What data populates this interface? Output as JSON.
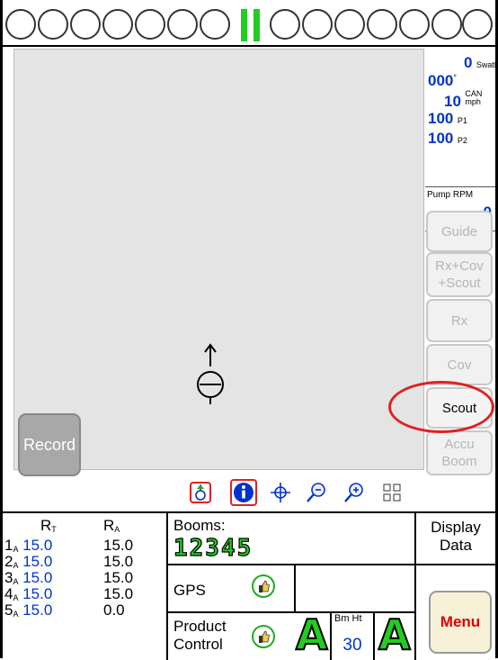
{
  "boom_circles": {
    "left_count": 7,
    "right_count": 7,
    "indicator_color": "#22cc22"
  },
  "status": {
    "swath_value": "0",
    "swath_unit": "Swath",
    "heading_value": "000",
    "heading_unit": "°",
    "speed_value": "10",
    "speed_unit_1": "CAN",
    "speed_unit_2": "mph",
    "p1_value": "100",
    "p1_unit": "P1",
    "p2_value": "100",
    "p2_unit": "P2",
    "pump_label": "Pump RPM",
    "pump_value": "0"
  },
  "buttons": {
    "guide": "Guide",
    "rx_cov_scout_1": "Rx+Cov",
    "rx_cov_scout_2": "+Scout",
    "rx": "Rx",
    "cov": "Cov",
    "scout": "Scout",
    "accu_1": "Accu",
    "accu_2": "Boom",
    "record": "Record",
    "menu": "Menu"
  },
  "rates": {
    "header_rt": "R",
    "header_rt_sub": "T",
    "header_ra": "R",
    "header_ra_sub": "A",
    "rows": [
      {
        "num": "1",
        "sub": "A",
        "rt": "15.0",
        "ra": "15.0"
      },
      {
        "num": "2",
        "sub": "A",
        "rt": "15.0",
        "ra": "15.0"
      },
      {
        "num": "3",
        "sub": "A",
        "rt": "15.0",
        "ra": "15.0"
      },
      {
        "num": "4",
        "sub": "A",
        "rt": "15.0",
        "ra": "15.0"
      },
      {
        "num": "5",
        "sub": "A",
        "rt": "15.0",
        "ra": "0.0"
      }
    ]
  },
  "booms": {
    "label": "Booms:",
    "numbers": "12345"
  },
  "display_data": {
    "line1": "Display",
    "line2": "Data"
  },
  "gps": {
    "label": "GPS"
  },
  "product_control": {
    "line1": "Product",
    "line2": "Control"
  },
  "boom_height": {
    "label": "Bm Ht",
    "value": "30"
  },
  "auto_letter": "A",
  "colors": {
    "accent_blue": "#0033cc",
    "green": "#22cc22",
    "menu_red": "#dd0000",
    "highlight_ring": "#dd2222"
  }
}
